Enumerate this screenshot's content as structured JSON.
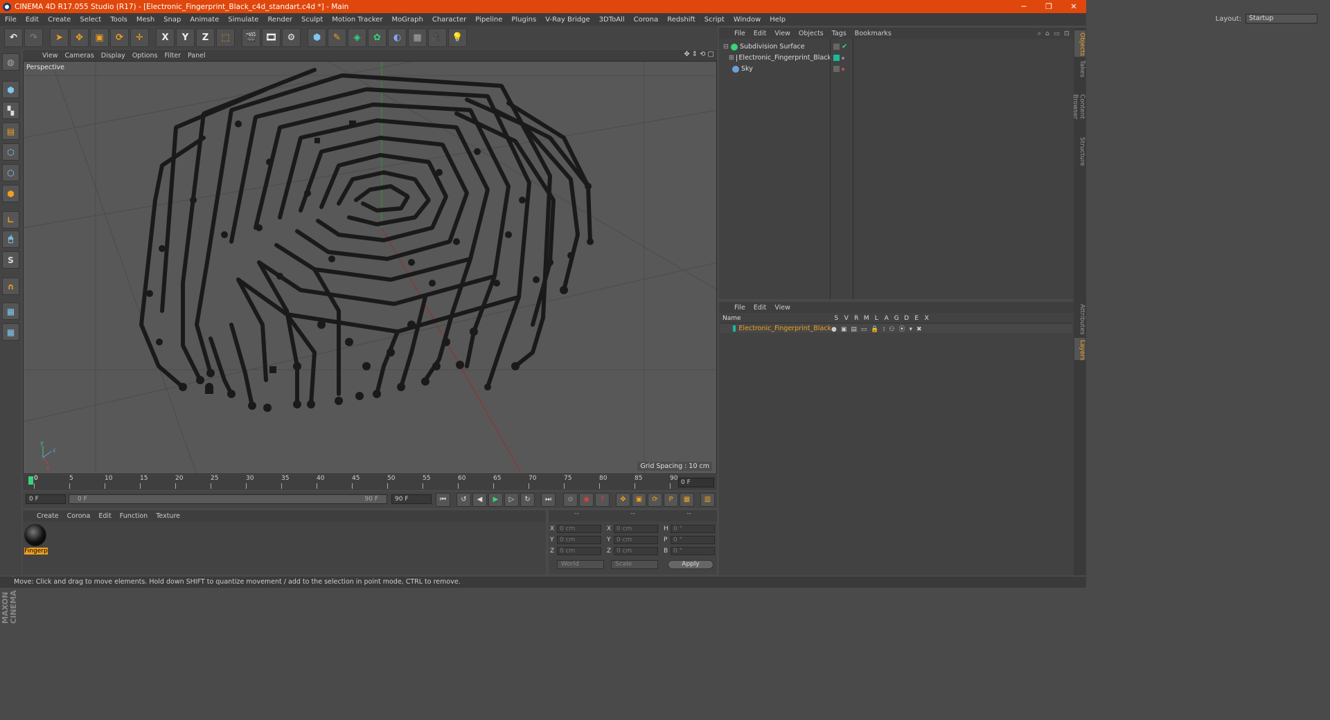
{
  "window": {
    "title": "CINEMA 4D R17.055 Studio (R17) - [Electronic_Fingerprint_Black_c4d_standart.c4d *] - Main",
    "controls": [
      "─",
      "❐",
      "✕"
    ]
  },
  "menubar": {
    "items": [
      "File",
      "Edit",
      "Create",
      "Select",
      "Tools",
      "Mesh",
      "Snap",
      "Animate",
      "Simulate",
      "Render",
      "Sculpt",
      "Motion Tracker",
      "MoGraph",
      "Character",
      "Pipeline",
      "Plugins",
      "V-Ray Bridge",
      "3DToAll",
      "Corona",
      "Redshift",
      "Script",
      "Window",
      "Help"
    ],
    "layout_label": "Layout:",
    "layout_value": "Startup"
  },
  "toolbar": {
    "axis_x": "X",
    "axis_y": "Y",
    "axis_z": "Z"
  },
  "viewport": {
    "menu": [
      "View",
      "Cameras",
      "Display",
      "Options",
      "Filter",
      "Panel"
    ],
    "label": "Perspective",
    "grid_spacing": "Grid Spacing : 10 cm",
    "axis_y": "y",
    "axis_z": "z",
    "axis_x": "x"
  },
  "timeline": {
    "ticks": [
      "0",
      "5",
      "10",
      "15",
      "20",
      "25",
      "30",
      "35",
      "40",
      "45",
      "50",
      "55",
      "60",
      "65",
      "70",
      "75",
      "80",
      "85",
      "90"
    ],
    "current_frame": "0 F"
  },
  "transport": {
    "start_frame": "0 F",
    "range_start": "0 F",
    "range_end": "90 F",
    "end_frame": "90 F"
  },
  "material_panel": {
    "menu": [
      "Create",
      "Corona",
      "Edit",
      "Function",
      "Texture"
    ],
    "material_name": "Fingerp"
  },
  "coords": {
    "headers": [
      "--",
      "--",
      "--"
    ],
    "rows": [
      {
        "l1": "X",
        "v1": "0 cm",
        "l2": "X",
        "v2": "0 cm",
        "l3": "H",
        "v3": "0 °"
      },
      {
        "l1": "Y",
        "v1": "0 cm",
        "l2": "Y",
        "v2": "0 cm",
        "l3": "P",
        "v3": "0 °"
      },
      {
        "l1": "Z",
        "v1": "0 cm",
        "l2": "Z",
        "v2": "0 cm",
        "l3": "B",
        "v3": "0 °"
      }
    ],
    "space": "World",
    "mode": "Scale",
    "apply": "Apply"
  },
  "object_manager": {
    "menu": [
      "File",
      "Edit",
      "View",
      "Objects",
      "Tags",
      "Bookmarks"
    ],
    "objects": [
      {
        "name": "Subdivision Surface",
        "icon_color": "#3ad27a"
      },
      {
        "name": "Electronic_Fingerprint_Black",
        "icon_color": "#cfcfcf"
      },
      {
        "name": "Sky",
        "icon_color": "#6f9fd8"
      }
    ]
  },
  "layer_manager": {
    "menu": [
      "File",
      "Edit",
      "View"
    ],
    "columns": [
      "Name",
      "S",
      "V",
      "R",
      "M",
      "L",
      "A",
      "G",
      "D",
      "E",
      "X"
    ],
    "layer_name": "Electronic_Fingerprint_Black",
    "layer_color": "#1fb89a"
  },
  "right_tabs": [
    "Objects",
    "Takes",
    "Content Browser",
    "Structure",
    "Attributes",
    "Layers"
  ],
  "status": "Move: Click and drag to move elements. Hold down SHIFT to quantize movement / add to the selection in point mode, CTRL to remove.",
  "branding": "MAXON CINEMA 4D",
  "colors": {
    "titlebar": "#e0470c",
    "accent": "#f0a020",
    "background": "#4a4a4a"
  }
}
